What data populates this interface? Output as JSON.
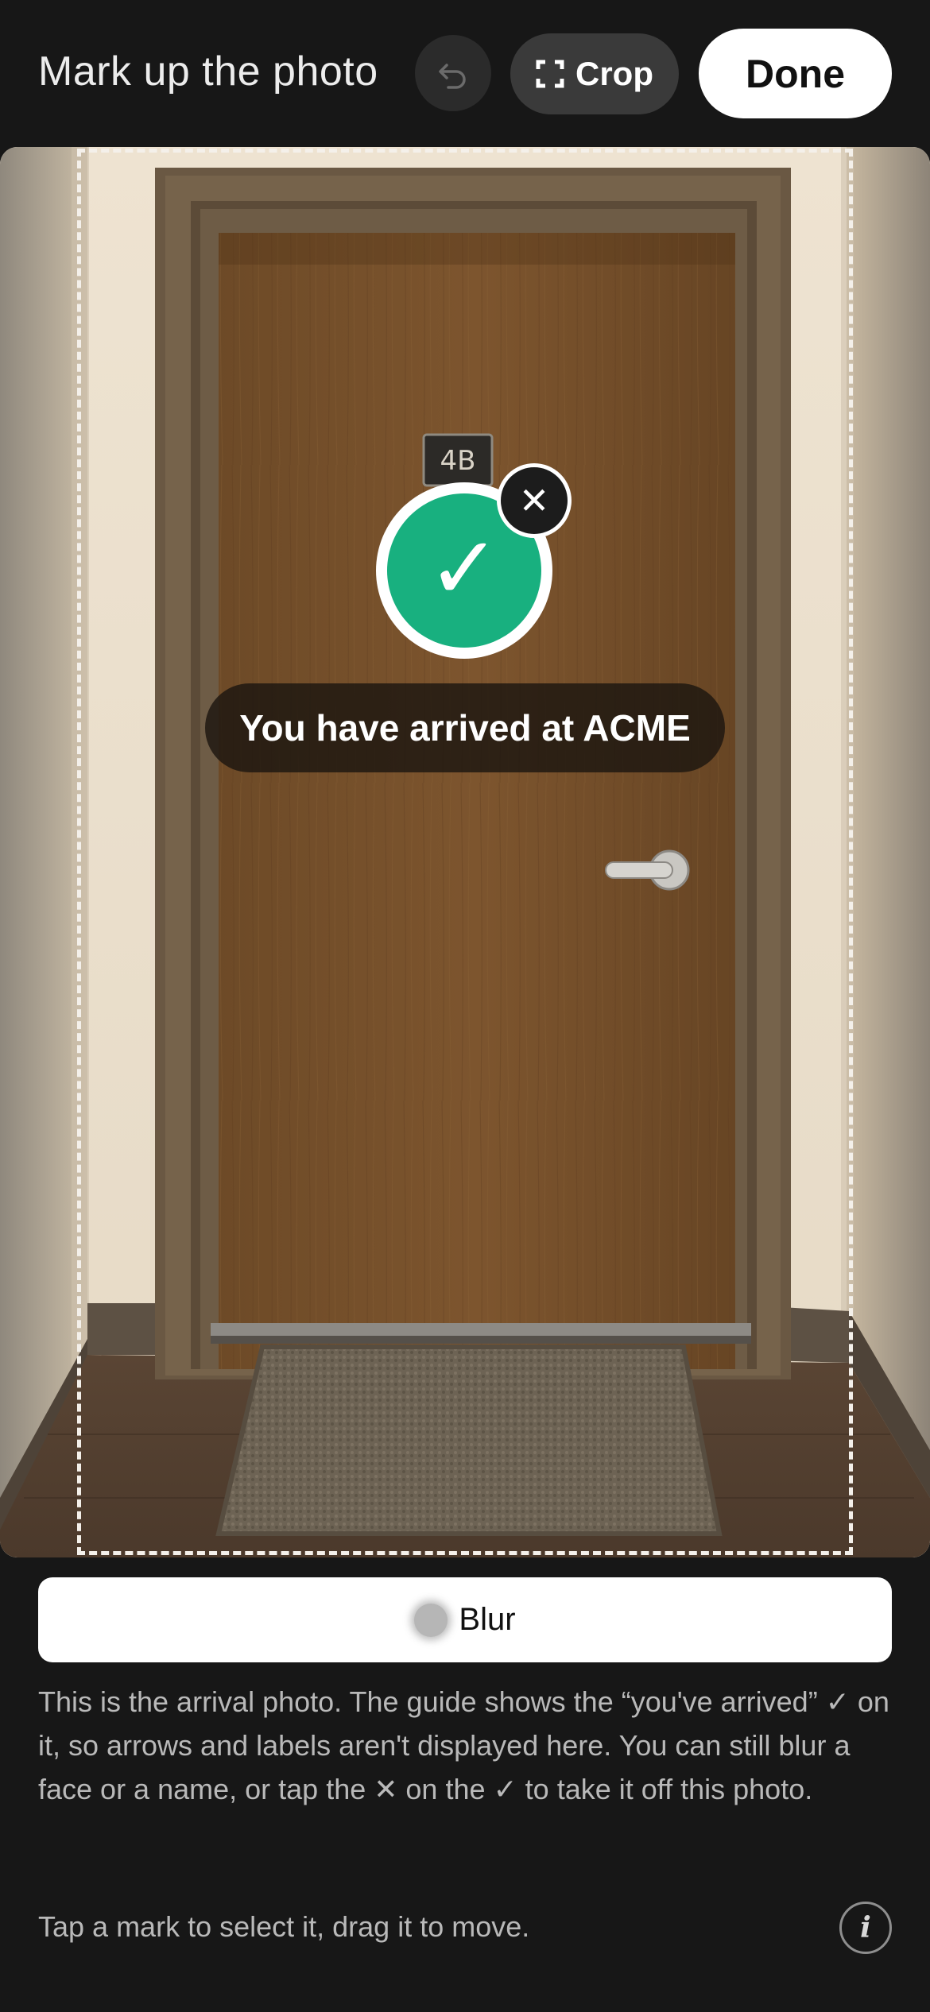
{
  "header": {
    "title": "Mark up the photo",
    "undo_icon": "undo-arrow",
    "crop_icon": "crop-corners",
    "crop_label": "Crop",
    "done_label": "Done"
  },
  "photo": {
    "room_sign": "4B",
    "check_icon": "checkmark",
    "check_glyph": "✓",
    "remove_glyph": "✕",
    "arrival_label": "You have arrived at ACME",
    "accent_color": "#18b07f"
  },
  "blur": {
    "label": "Blur"
  },
  "info_text": "This is the arrival photo. The guide shows the “you've arrived” ✓ on it, so arrows and labels aren't displayed here. You can still blur a face or a name, or tap the ✕ on the ✓ to take it off this photo.",
  "hint_text": "Tap a mark to select it, drag it to move.",
  "info_icon_glyph": "i"
}
